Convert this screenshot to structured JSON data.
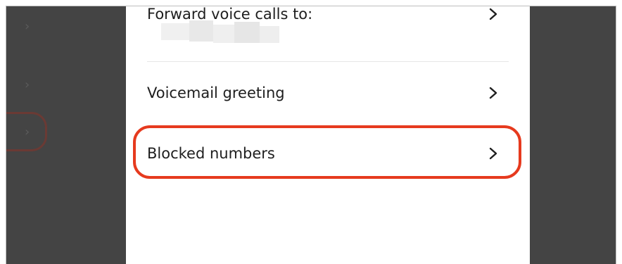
{
  "settings": {
    "forward_calls": {
      "label": "Forward voice calls to:"
    },
    "voicemail_greeting": {
      "label": "Voicemail greeting"
    },
    "blocked_numbers": {
      "label": "Blocked numbers"
    }
  },
  "colors": {
    "highlight": "#e63a1e",
    "overlay": "#444444",
    "text": "#1e1e1e"
  },
  "icons": [
    "chevron-right-icon"
  ]
}
